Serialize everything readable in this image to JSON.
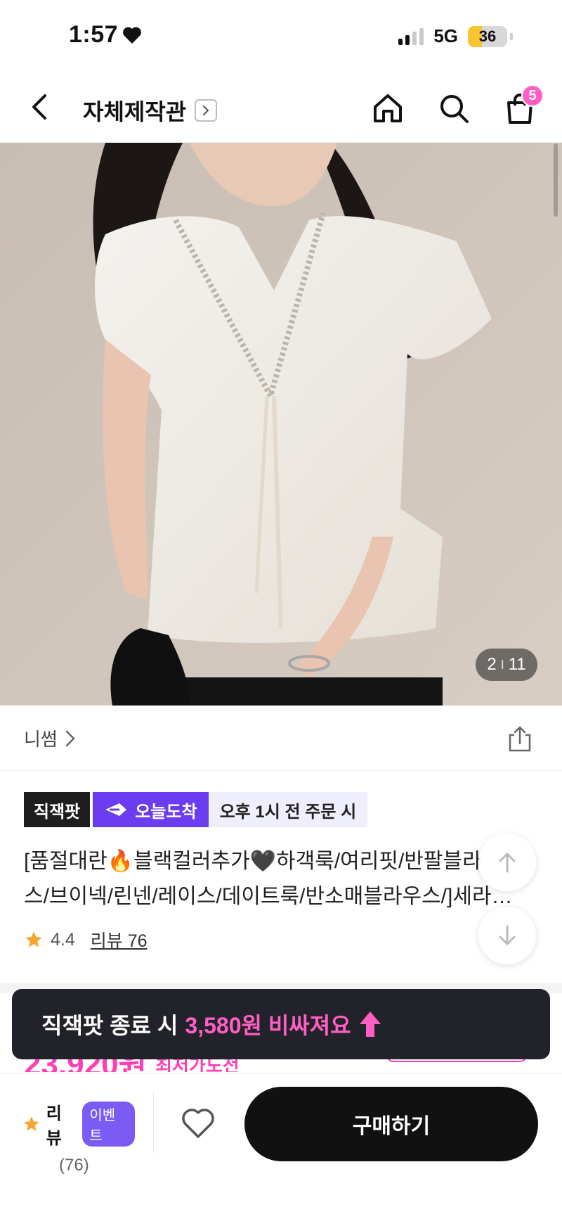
{
  "status_bar": {
    "time": "1:57",
    "network": "5G",
    "battery": "36",
    "battery_level": 0.36
  },
  "header": {
    "title": "자체제작관",
    "cart_count": "5",
    "icons": [
      "back-arrow-icon",
      "chevron-right-icon",
      "home-icon",
      "search-icon",
      "cart-icon"
    ]
  },
  "gallery": {
    "current": "2",
    "separator": "I",
    "total": "11"
  },
  "brand": {
    "name": "니썸"
  },
  "badges": {
    "direct": "직잭팟",
    "today": "오늘도착",
    "deadline": "오후 1시 전 주문 시"
  },
  "product": {
    "title_line1": "[품절대란🔥블랙컬러추가🖤하객룩/여리핏/반팔블라",
    "title_line2": "스/브이넥/린넨/레이스/데이트룩/반소매블라우스/]세라…",
    "rating": "4.4",
    "review_label": "리뷰 76"
  },
  "price_peek": {
    "price": "23,920원",
    "label": "최저가도전"
  },
  "toast": {
    "prefix": "직잭팟 종료 시",
    "amount": "3,580원 비싸져요"
  },
  "bottom_bar": {
    "review_label": "리뷰",
    "event_label": "이벤트",
    "review_count": "(76)",
    "buy_label": "구매하기"
  },
  "colors": {
    "accent_pink": "#ff3fb5",
    "purple": "#6c3cf0",
    "star": "#f7a531",
    "dark": "#111111"
  }
}
